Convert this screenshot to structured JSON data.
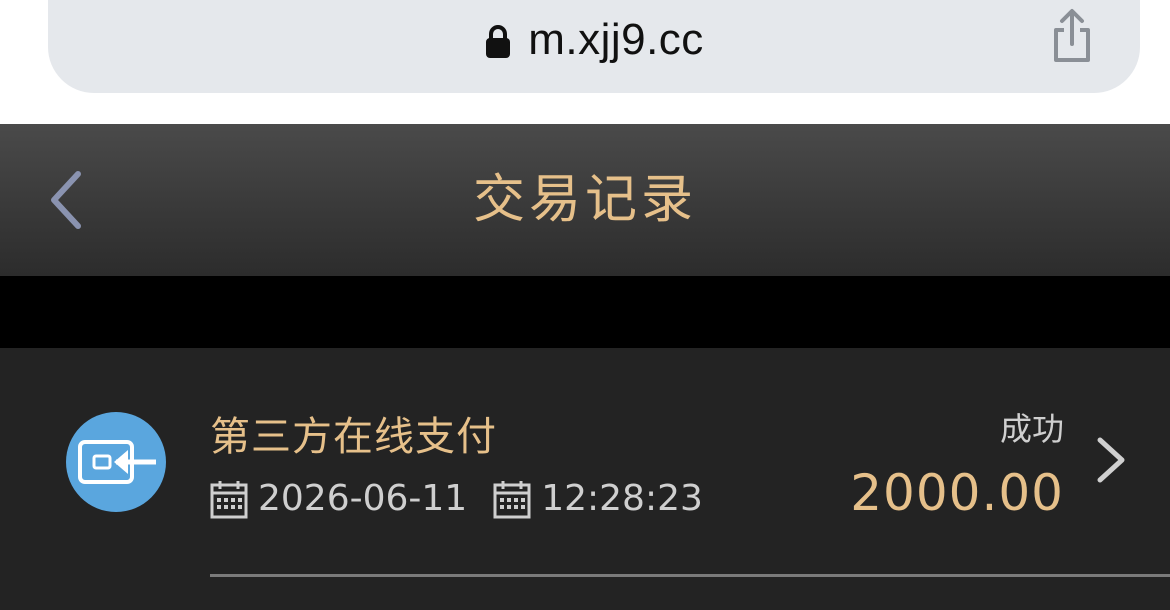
{
  "browser": {
    "url": "m.xjj9.cc",
    "lock_icon": "lock-icon",
    "share_icon": "share-icon"
  },
  "header": {
    "title": "交易记录",
    "back_icon": "chevron-left-icon",
    "title_color": "#e6c08a"
  },
  "record": {
    "type_label": "第三方在线支付",
    "icon": "wallet-deposit-icon",
    "date": "2026-06-11",
    "time": "12:28:23",
    "status": "成功",
    "amount": "2000.00",
    "chevron_icon": "chevron-right-icon",
    "accent_color": "#e6c08a"
  }
}
